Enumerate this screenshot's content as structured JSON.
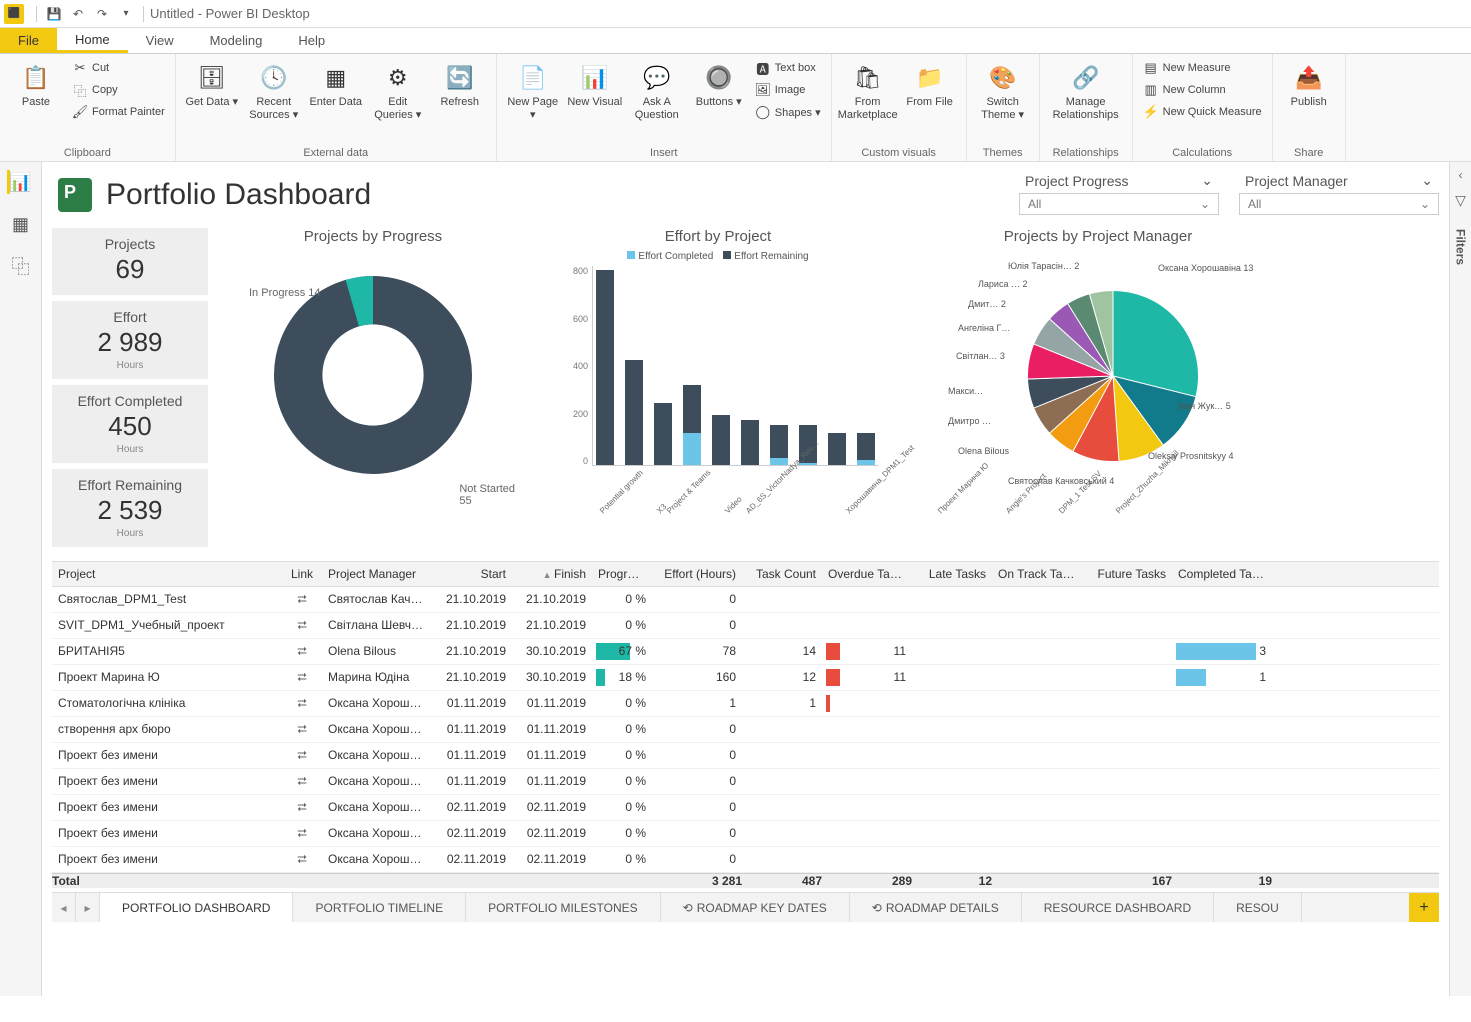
{
  "titlebar": {
    "title": "Untitled - Power BI Desktop"
  },
  "ribbon_tabs": {
    "file": "File",
    "home": "Home",
    "view": "View",
    "modeling": "Modeling",
    "help": "Help"
  },
  "ribbon": {
    "clipboard": {
      "label": "Clipboard",
      "paste": "Paste",
      "cut": "Cut",
      "copy": "Copy",
      "format_painter": "Format Painter"
    },
    "external": {
      "label": "External data",
      "get_data": "Get Data ▾",
      "recent": "Recent Sources ▾",
      "enter": "Enter Data",
      "edit_q": "Edit Queries ▾",
      "refresh": "Refresh"
    },
    "insert": {
      "label": "Insert",
      "new_page": "New Page ▾",
      "new_visual": "New Visual",
      "ask": "Ask A Question",
      "buttons": "Buttons ▾",
      "textbox": "Text box",
      "image": "Image",
      "shapes": "Shapes ▾"
    },
    "custom": {
      "label": "Custom visuals",
      "market": "From Marketplace",
      "file": "From File"
    },
    "themes": {
      "label": "Themes",
      "switch": "Switch Theme ▾"
    },
    "rel": {
      "label": "Relationships",
      "manage": "Manage Relationships"
    },
    "calc": {
      "label": "Calculations",
      "nm": "New Measure",
      "nc": "New Column",
      "nqm": "New Quick Measure"
    },
    "share": {
      "label": "Share",
      "publish": "Publish"
    }
  },
  "slicers": {
    "s1": {
      "title": "Project Progress",
      "value": "All"
    },
    "s2": {
      "title": "Project Manager",
      "value": "All"
    }
  },
  "filters_label": "Filters",
  "dash": {
    "title": "Portfolio Dashboard"
  },
  "kpi": {
    "projects": {
      "label": "Projects",
      "val": "69"
    },
    "effort": {
      "label": "Effort",
      "val": "2 989",
      "unit": "Hours"
    },
    "ec": {
      "label": "Effort Completed",
      "val": "450",
      "unit": "Hours"
    },
    "er": {
      "label": "Effort Remaining",
      "val": "2 539",
      "unit": "Hours"
    }
  },
  "chart_data": [
    {
      "type": "pie",
      "title": "Projects by Progress",
      "categories": [
        "In Progress",
        "Not Started"
      ],
      "values": [
        14,
        55
      ],
      "colors": [
        "#1fb8a6",
        "#3d4d5c"
      ],
      "donut": true
    },
    {
      "type": "bar",
      "stacked": true,
      "title": "Effort by Project",
      "ylabel": "",
      "ylim": [
        0,
        800
      ],
      "yticks": [
        0,
        200,
        400,
        600,
        800
      ],
      "categories": [
        "Potential growth",
        "X3",
        "Project & Teams",
        "Video",
        "AD_6S_VictorNadya_Rec…",
        "Хорошавина_DPM1_Test",
        "Проект Марина Ю",
        "Angie's Project",
        "DPM_1 Test SV",
        "Project_Zhuzha_Mikhail"
      ],
      "series": [
        {
          "name": "Effort Completed",
          "color": "#6bc5e8",
          "values": [
            0,
            0,
            0,
            130,
            0,
            0,
            30,
            10,
            0,
            20
          ]
        },
        {
          "name": "Effort Remaining",
          "color": "#3d4d5c",
          "values": [
            780,
            420,
            250,
            190,
            200,
            180,
            130,
            150,
            130,
            110
          ]
        }
      ]
    },
    {
      "type": "pie",
      "title": "Projects by Project Manager",
      "labels": [
        {
          "name": "Оксана Хорошавіна",
          "value": 13
        },
        {
          "name": "Іван Жук…",
          "value": 5
        },
        {
          "name": "Oleksiy Prosnitskyy",
          "value": 4
        },
        {
          "name": "Святослав Качковський",
          "value": 4
        },
        {
          "name": "Olena Bilous",
          "value": ""
        },
        {
          "name": "Дмитро …",
          "value": ""
        },
        {
          "name": "Макси…",
          "value": ""
        },
        {
          "name": "Світлан…",
          "value": 3
        },
        {
          "name": "Ангеліна Г…",
          "value": ""
        },
        {
          "name": "Дмит…",
          "value": 2
        },
        {
          "name": "Лариса …",
          "value": 2
        },
        {
          "name": "Юлія Тарасін…",
          "value": 2
        }
      ],
      "colors": [
        "#1fb8a6",
        "#117a8b",
        "#f2c811",
        "#e74c3c",
        "#f39c12",
        "#8e6e53",
        "#3d4d5c",
        "#e91e63",
        "#95a5a6",
        "#9b59b6",
        "#5b8a72",
        "#a0c4a0"
      ]
    }
  ],
  "charts": {
    "donut": {
      "title": "Projects by Progress",
      "inprog": "In Progress 14",
      "notstarted": "Not Started\n55"
    },
    "bars": {
      "title": "Effort by Project",
      "legend_a": "Effort Completed",
      "legend_b": "Effort Remaining"
    },
    "pie": {
      "title": "Projects by Project Manager"
    }
  },
  "table": {
    "headers": {
      "project": "Project",
      "link": "Link",
      "pm": "Project Manager",
      "start": "Start",
      "finish": "Finish",
      "progress": "Progress",
      "effort": "Effort (Hours)",
      "tc": "Task Count",
      "od": "Overdue Tasks",
      "lt": "Late Tasks",
      "ot": "On Track Tasks",
      "ft": "Future Tasks",
      "ct": "Completed Tasks"
    },
    "rows": [
      {
        "project": "Святослав_DPM1_Test",
        "pm": "Святослав Кач…",
        "start": "21.10.2019",
        "finish": "21.10.2019",
        "prog": "0 %",
        "eff": "0",
        "tc": "",
        "od": "",
        "lt": "",
        "ot": "",
        "ft": "",
        "ct": ""
      },
      {
        "project": "SVIT_DPM1_Учебный_проект",
        "pm": "Світлана Шевче…",
        "start": "21.10.2019",
        "finish": "21.10.2019",
        "prog": "0 %",
        "eff": "0",
        "tc": "",
        "od": "",
        "lt": "",
        "ot": "",
        "ft": "",
        "ct": ""
      },
      {
        "project": "БРИТАНІЯ5",
        "pm": "Olena Bilous",
        "start": "21.10.2019",
        "finish": "30.10.2019",
        "prog": "67 %",
        "progbar": 67,
        "eff": "78",
        "tc": "14",
        "od": "11",
        "odred": true,
        "lt": "",
        "ot": "",
        "ft": "",
        "ct": "3",
        "ctbar": 80
      },
      {
        "project": "Проект Марина Ю",
        "pm": "Марина Юдіна",
        "start": "21.10.2019",
        "finish": "30.10.2019",
        "prog": "18 %",
        "progbar": 18,
        "eff": "160",
        "tc": "12",
        "od": "11",
        "odred": true,
        "lt": "",
        "ot": "",
        "ft": "",
        "ct": "1",
        "ctbar": 30
      },
      {
        "project": "Стоматологічна клініка",
        "pm": "Оксана Хороша…",
        "start": "01.11.2019",
        "finish": "01.11.2019",
        "prog": "0 %",
        "eff": "1",
        "tc": "1",
        "od": "",
        "odsm": true,
        "lt": "",
        "ot": "",
        "ft": "",
        "ct": ""
      },
      {
        "project": "створення арх бюро",
        "pm": "Оксана Хороша…",
        "start": "01.11.2019",
        "finish": "01.11.2019",
        "prog": "0 %",
        "eff": "0",
        "tc": "",
        "od": "",
        "lt": "",
        "ot": "",
        "ft": "",
        "ct": ""
      },
      {
        "project": "Проект без имени",
        "pm": "Оксана Хороша…",
        "start": "01.11.2019",
        "finish": "01.11.2019",
        "prog": "0 %",
        "eff": "0",
        "tc": "",
        "od": "",
        "lt": "",
        "ot": "",
        "ft": "",
        "ct": ""
      },
      {
        "project": "Проект без имени",
        "pm": "Оксана Хороша…",
        "start": "01.11.2019",
        "finish": "01.11.2019",
        "prog": "0 %",
        "eff": "0",
        "tc": "",
        "od": "",
        "lt": "",
        "ot": "",
        "ft": "",
        "ct": ""
      },
      {
        "project": "Проект без имени",
        "pm": "Оксана Хороша…",
        "start": "02.11.2019",
        "finish": "02.11.2019",
        "prog": "0 %",
        "eff": "0",
        "tc": "",
        "od": "",
        "lt": "",
        "ot": "",
        "ft": "",
        "ct": ""
      },
      {
        "project": "Проект без имени",
        "pm": "Оксана Хороша…",
        "start": "02.11.2019",
        "finish": "02.11.2019",
        "prog": "0 %",
        "eff": "0",
        "tc": "",
        "od": "",
        "lt": "",
        "ot": "",
        "ft": "",
        "ct": ""
      },
      {
        "project": "Проект без имени",
        "pm": "Оксана Хороша…",
        "start": "02.11.2019",
        "finish": "02.11.2019",
        "prog": "0 %",
        "eff": "0",
        "tc": "",
        "od": "",
        "lt": "",
        "ot": "",
        "ft": "",
        "ct": ""
      }
    ],
    "total": {
      "label": "Total",
      "eff": "3 281",
      "tc": "487",
      "od": "289",
      "lt": "12",
      "ot": "",
      "ft": "167",
      "ct": "19"
    }
  },
  "page_tabs": {
    "t1": "PORTFOLIO DASHBOARD",
    "t2": "PORTFOLIO TIMELINE",
    "t3": "PORTFOLIO MILESTONES",
    "t4": "ROADMAP KEY DATES",
    "t5": "ROADMAP DETAILS",
    "t6": "RESOURCE DASHBOARD",
    "t7": "RESOU"
  }
}
